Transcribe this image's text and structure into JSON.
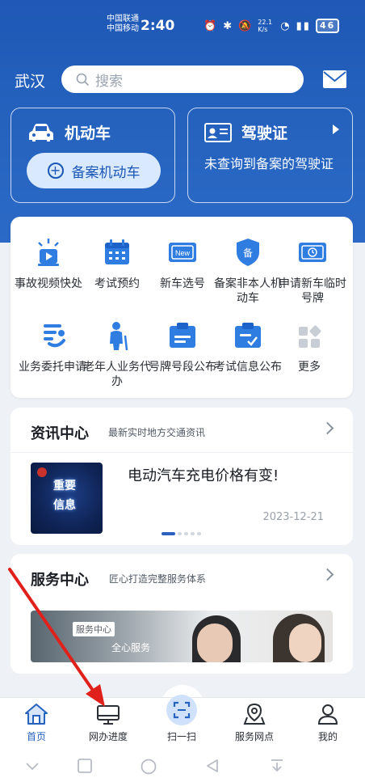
{
  "status_bar": {
    "carrier1": "中国联通",
    "carrier2": "中国移动",
    "time": "2:40",
    "net_speed": "22.1 K/s",
    "battery": "46"
  },
  "header": {
    "city": "武汉",
    "search_placeholder": "搜索"
  },
  "vehicle_card": {
    "title": "机动车",
    "button_label": "备案机动车"
  },
  "license_card": {
    "title": "驾驶证",
    "status_text": "未查询到备案的驾驶证"
  },
  "services": [
    {
      "label": "事故视频快处",
      "icon": "siren-icon"
    },
    {
      "label": "考试预约",
      "icon": "calendar-icon"
    },
    {
      "label": "新车选号",
      "icon": "new-plate-icon"
    },
    {
      "label": "备案非本人机动车",
      "icon": "shield-icon"
    },
    {
      "label": "申请新车临时号牌",
      "icon": "temp-plate-icon"
    },
    {
      "label": "业务委托申请",
      "icon": "delegate-icon"
    },
    {
      "label": "老年人业务代办",
      "icon": "elderly-icon"
    },
    {
      "label": "号牌号段公布",
      "icon": "plate-number-icon"
    },
    {
      "label": "考试信息公布",
      "icon": "exam-info-icon"
    },
    {
      "label": "更多",
      "icon": "more-icon"
    }
  ],
  "news_section": {
    "title": "资讯中心",
    "subtitle": "最新实时地方交通资讯",
    "thumb_line1": "重要",
    "thumb_line2": "信息",
    "headline": "电动汽车充电价格有变!",
    "date": "2023-12-21"
  },
  "service_section": {
    "title": "服务中心",
    "subtitle": "匠心打造完整服务体系",
    "banner_tag": "服务中心",
    "banner_caption": "全心服务"
  },
  "tabbar": [
    {
      "label": "首页",
      "icon": "home-icon",
      "active": true
    },
    {
      "label": "网办进度",
      "icon": "monitor-icon",
      "active": false
    },
    {
      "label": "扫一扫",
      "icon": "scan-icon",
      "active": false
    },
    {
      "label": "服务网点",
      "icon": "map-pin-icon",
      "active": false
    },
    {
      "label": "我的",
      "icon": "user-icon",
      "active": false
    }
  ],
  "colors": {
    "brand_blue": "#2563bf",
    "annotation_arrow": "#e0201b"
  }
}
